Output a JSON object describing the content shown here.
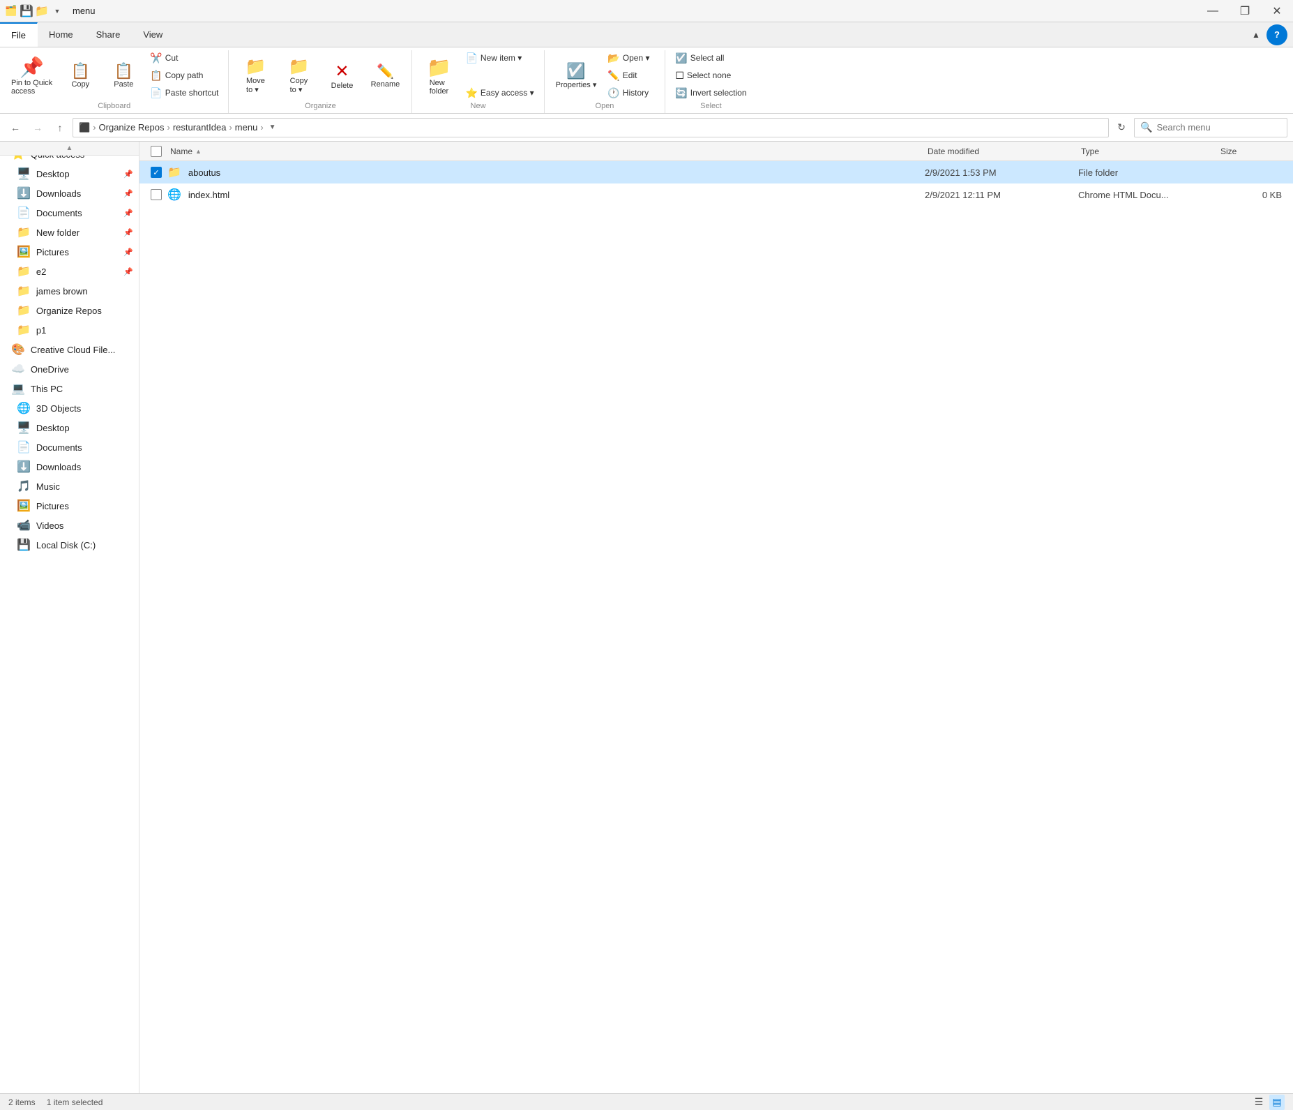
{
  "titleBar": {
    "name": "menu",
    "minimizeLabel": "—",
    "restoreLabel": "❐",
    "closeLabel": "✕"
  },
  "tabs": {
    "items": [
      {
        "id": "file",
        "label": "File",
        "active": true
      },
      {
        "id": "home",
        "label": "Home",
        "active": false
      },
      {
        "id": "share",
        "label": "Share",
        "active": false
      },
      {
        "id": "view",
        "label": "View",
        "active": false
      }
    ]
  },
  "ribbon": {
    "groups": [
      {
        "id": "clipboard",
        "label": "Clipboard",
        "items": [
          {
            "id": "pin-quick-access",
            "label": "Pin to Quick\naccess",
            "icon": "📌"
          },
          {
            "id": "copy",
            "label": "Copy",
            "icon": "📋"
          },
          {
            "id": "paste",
            "label": "Paste",
            "icon": "📄"
          }
        ],
        "smallItems": [
          {
            "id": "cut",
            "label": "Cut",
            "icon": "✂️"
          },
          {
            "id": "copy-path",
            "label": "Copy path",
            "icon": "📋"
          },
          {
            "id": "paste-shortcut",
            "label": "Paste shortcut",
            "icon": "📄"
          }
        ]
      },
      {
        "id": "organize",
        "label": "Organize",
        "items": [
          {
            "id": "move-to",
            "label": "Move\nto",
            "icon": "📁",
            "dropdown": true
          },
          {
            "id": "copy-to",
            "label": "Copy\nto",
            "icon": "📁",
            "dropdown": true
          },
          {
            "id": "delete",
            "label": "Delete",
            "icon": "🗑️"
          },
          {
            "id": "rename",
            "label": "Rename",
            "icon": "✏️"
          }
        ]
      },
      {
        "id": "new",
        "label": "New",
        "items": [
          {
            "id": "new-folder",
            "label": "New\nfolder",
            "icon": "📁"
          },
          {
            "id": "new-item",
            "label": "New item",
            "icon": "📄",
            "dropdown": true
          },
          {
            "id": "easy-access",
            "label": "Easy access",
            "icon": "⭐",
            "dropdown": true
          }
        ]
      },
      {
        "id": "open",
        "label": "Open",
        "items": [
          {
            "id": "properties",
            "label": "Properties",
            "icon": "ℹ️",
            "dropdown": true
          },
          {
            "id": "open-btn",
            "label": "Open",
            "icon": "📂",
            "dropdown": true
          },
          {
            "id": "edit",
            "label": "Edit",
            "icon": "✏️"
          },
          {
            "id": "history",
            "label": "History",
            "icon": "🕐"
          }
        ]
      },
      {
        "id": "select",
        "label": "Select",
        "items": [
          {
            "id": "select-all",
            "label": "Select all",
            "icon": "☑️"
          },
          {
            "id": "select-none",
            "label": "Select none",
            "icon": "☐"
          },
          {
            "id": "invert-selection",
            "label": "Invert selection",
            "icon": "🔄"
          }
        ]
      }
    ]
  },
  "addressBar": {
    "backDisabled": false,
    "forwardDisabled": true,
    "upDisabled": false,
    "breadcrumbs": [
      "Organize Repos",
      "resturantIdea",
      "menu"
    ],
    "refreshLabel": "↻",
    "searchPlaceholder": "Search menu"
  },
  "sidebar": {
    "quickAccess": {
      "label": "Quick access",
      "items": [
        {
          "id": "desktop",
          "label": "Desktop",
          "icon": "🖥️",
          "pinned": true
        },
        {
          "id": "downloads",
          "label": "Downloads",
          "icon": "⬇️",
          "pinned": true
        },
        {
          "id": "documents",
          "label": "Documents",
          "icon": "📄",
          "pinned": true
        },
        {
          "id": "new-folder",
          "label": "New folder",
          "icon": "📁",
          "pinned": true
        },
        {
          "id": "pictures",
          "label": "Pictures",
          "icon": "🖼️",
          "pinned": true
        },
        {
          "id": "e2",
          "label": "e2",
          "icon": "📁",
          "pinned": true
        },
        {
          "id": "james-brown",
          "label": "james brown",
          "icon": "📁",
          "pinned": false
        },
        {
          "id": "organize-repos",
          "label": "Organize Repos",
          "icon": "📁",
          "pinned": false
        },
        {
          "id": "p1",
          "label": "p1",
          "icon": "📁",
          "pinned": false
        }
      ]
    },
    "creativeCloud": {
      "label": "Creative Cloud Files",
      "icon": "☁️"
    },
    "oneDrive": {
      "label": "OneDrive",
      "icon": "☁️"
    },
    "thisPC": {
      "label": "This PC",
      "icon": "💻",
      "items": [
        {
          "id": "3d-objects",
          "label": "3D Objects",
          "icon": "🌐"
        },
        {
          "id": "desktop-pc",
          "label": "Desktop",
          "icon": "🖥️"
        },
        {
          "id": "documents-pc",
          "label": "Documents",
          "icon": "📄"
        },
        {
          "id": "downloads-pc",
          "label": "Downloads",
          "icon": "⬇️"
        },
        {
          "id": "music",
          "label": "Music",
          "icon": "🎵"
        },
        {
          "id": "pictures-pc",
          "label": "Pictures",
          "icon": "🖼️"
        },
        {
          "id": "videos",
          "label": "Videos",
          "icon": "📹"
        },
        {
          "id": "local-disk",
          "label": "Local Disk (C:)",
          "icon": "💾"
        }
      ]
    }
  },
  "fileList": {
    "columns": {
      "name": "Name",
      "dateModified": "Date modified",
      "type": "Type",
      "size": "Size"
    },
    "files": [
      {
        "id": "aboutus",
        "name": "aboutus",
        "icon": "📁",
        "dateModified": "2/9/2021 1:53 PM",
        "type": "File folder",
        "size": "",
        "selected": true,
        "isFolder": true
      },
      {
        "id": "index-html",
        "name": "index.html",
        "icon": "🌐",
        "dateModified": "2/9/2021 12:11 PM",
        "type": "Chrome HTML Docu...",
        "size": "0 KB",
        "selected": false,
        "isFolder": false
      }
    ]
  },
  "statusBar": {
    "itemCount": "2 items",
    "selectedCount": "1 item selected"
  }
}
